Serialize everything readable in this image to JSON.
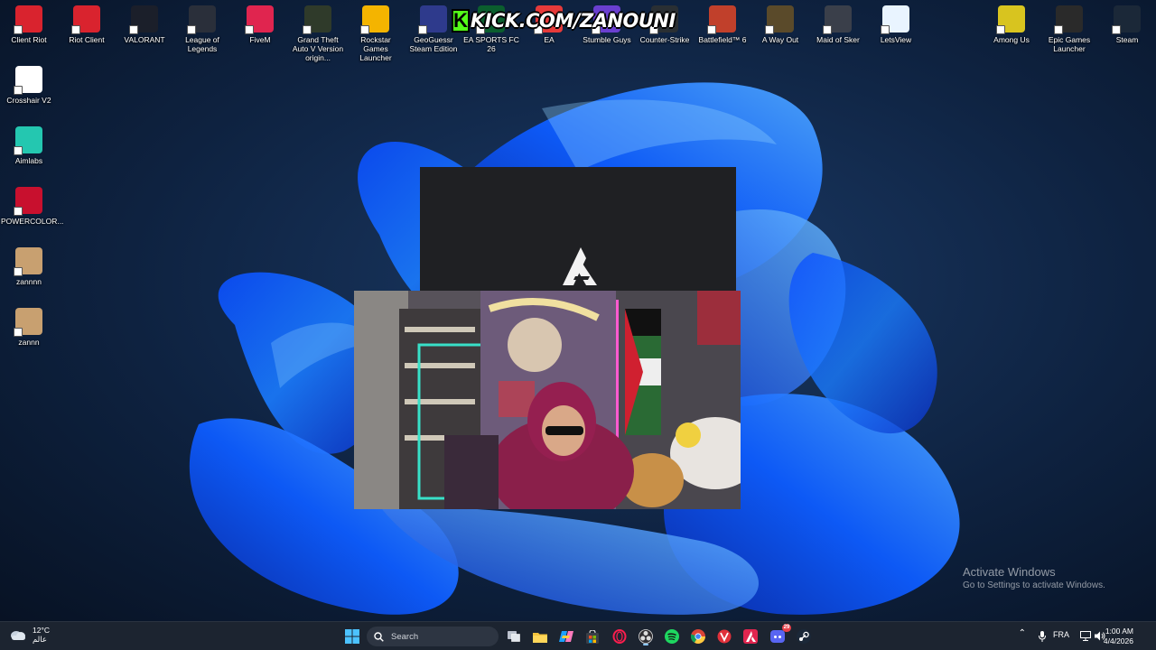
{
  "desktop": {
    "top_row": [
      {
        "label": "Client Riot",
        "icon": "riot-fist-icon",
        "color": "#d9232e"
      },
      {
        "label": "Riot Client",
        "icon": "riot-fist-icon",
        "color": "#d9232e"
      },
      {
        "label": "VALORANT",
        "icon": "valorant-icon",
        "color": "#1b1f2a"
      },
      {
        "label": "League of Legends",
        "icon": "league-icon",
        "color": "#2a2f3a"
      },
      {
        "label": "FiveM",
        "icon": "fivem-icon",
        "color": "#e0254f"
      },
      {
        "label": "Grand Theft Auto V Version origin...",
        "icon": "gta-icon",
        "color": "#2f3a2a"
      },
      {
        "label": "Rockstar Games Launcher",
        "icon": "rockstar-icon",
        "color": "#f4b400"
      },
      {
        "label": "GeoGuessr Steam Edition",
        "icon": "geoguessr-icon",
        "color": "#2e3a8c"
      },
      {
        "label": "EA SPORTS FC 26",
        "icon": "easfc-icon",
        "color": "#0b5e2e"
      },
      {
        "label": "EA",
        "icon": "ea-icon",
        "color": "#e63a3a"
      },
      {
        "label": "Stumble Guys",
        "icon": "stumble-icon",
        "color": "#6a3fd0"
      },
      {
        "label": "Counter-Strike",
        "icon": "cs-icon",
        "color": "#2a2f33"
      },
      {
        "label": "Battlefield™ 6",
        "icon": "battlefield-icon",
        "color": "#c1402b"
      },
      {
        "label": "A Way Out",
        "icon": "awayout-icon",
        "color": "#5a4a2a"
      },
      {
        "label": "Maid of Sker",
        "icon": "maidofsker-icon",
        "color": "#3a3f4a"
      },
      {
        "label": "LetsView",
        "icon": "letsview-icon",
        "color": "#e9f4ff"
      }
    ],
    "right_row": [
      {
        "label": "Among Us",
        "icon": "among-us-icon",
        "color": "#d8c41f"
      },
      {
        "label": "Epic Games Launcher",
        "icon": "epic-games-icon",
        "color": "#2a2a2a"
      },
      {
        "label": "Steam",
        "icon": "steam-icon",
        "color": "#1b2838"
      }
    ],
    "left_column": [
      {
        "label": "Crosshair V2",
        "icon": "crosshair-icon",
        "color": "#ffffff"
      },
      {
        "label": "Aimlabs",
        "icon": "aimlabs-icon",
        "color": "#24c7b0"
      },
      {
        "label": "POWERCOLOR...",
        "icon": "powercolor-icon",
        "color": "#c8102e"
      },
      {
        "label": "zannnn",
        "icon": "photo-icon",
        "color": "#c8a070"
      },
      {
        "label": "zannn",
        "icon": "photo-icon",
        "color": "#c8a070"
      }
    ]
  },
  "overlay": {
    "kick_logo": "K",
    "kick_url": "KICK.COM/ZANOUNI"
  },
  "watermark": {
    "title": "Activate Windows",
    "subtitle": "Go to Settings to activate Windows."
  },
  "taskbar": {
    "weather_temp": "12°C",
    "weather_desc": "عالم",
    "search_placeholder": "Search",
    "language": "FRA",
    "time": "1:00 AM",
    "date": "4/4/2026",
    "discord_badge": "29"
  },
  "colors": {
    "accent": "#0a6cff",
    "taskbar_bg": "#1c2430",
    "kick_green": "#53fc18"
  }
}
